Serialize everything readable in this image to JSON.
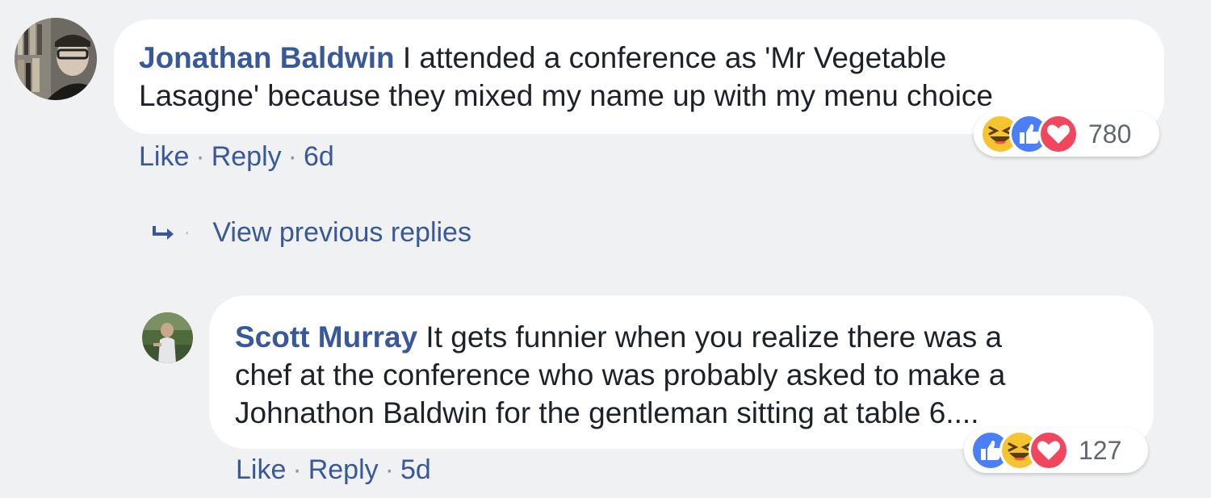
{
  "comments": [
    {
      "author": "Jonathan Baldwin",
      "text_line1": " I attended a conference as 'Mr Vegetable",
      "text_line2": "Lasagne' because they mixed my name up with my menu choice",
      "reaction_count": "780",
      "reactions": [
        "haha-icon",
        "like-icon",
        "love-icon"
      ],
      "like_label": "Like",
      "reply_label": "Reply",
      "time": "6d"
    },
    {
      "author": "Scott Murray",
      "text_line1": " It gets funnier when you realize there was a",
      "text_line2": "chef at the conference who was probably asked to make a",
      "text_line3": "Johnathon Baldwin for the gentleman sitting at table 6....",
      "reaction_count": "127",
      "reactions": [
        "like-icon",
        "haha-icon",
        "love-icon"
      ],
      "like_label": "Like",
      "reply_label": "Reply",
      "time": "5d"
    }
  ],
  "view_previous_replies": "View previous replies",
  "separator": "·",
  "colors": {
    "background": "#f0f1f3",
    "link": "#385898",
    "text": "#1d2129",
    "like": "#4a7ff7",
    "love": "#f0475e",
    "haha": "#f7c431"
  }
}
